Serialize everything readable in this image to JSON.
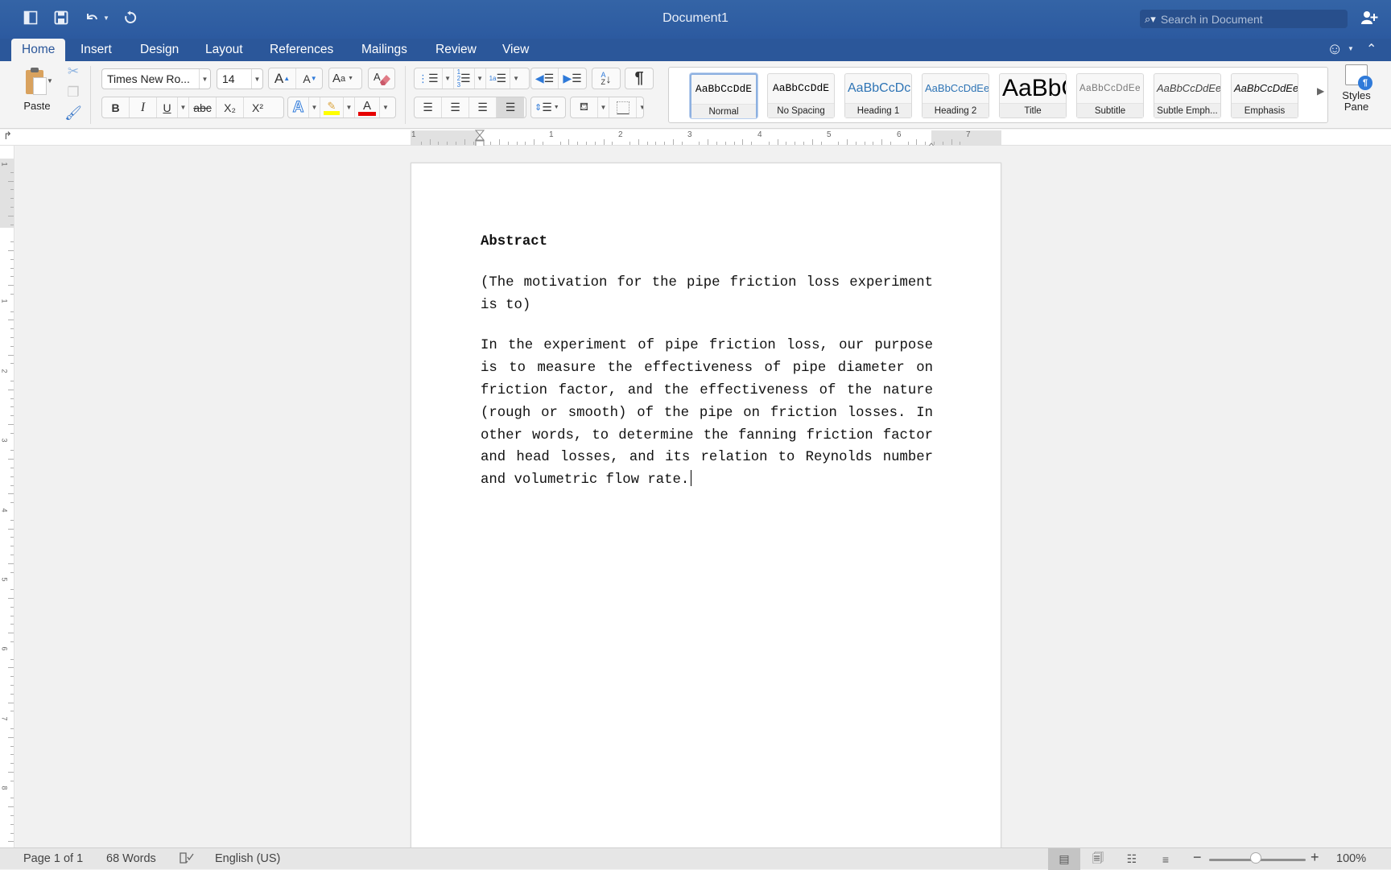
{
  "window": {
    "title": "Document1",
    "search_placeholder": "Search in Document"
  },
  "quick_access": {
    "sidebar": "sidebar-toggle",
    "save": "save",
    "undo": "undo",
    "redo": "redo"
  },
  "tabs": [
    {
      "label": "Home",
      "active": true
    },
    {
      "label": "Insert"
    },
    {
      "label": "Design"
    },
    {
      "label": "Layout"
    },
    {
      "label": "References"
    },
    {
      "label": "Mailings"
    },
    {
      "label": "Review"
    },
    {
      "label": "View"
    }
  ],
  "ribbon": {
    "paste_label": "Paste",
    "font_name": "Times New Ro...",
    "font_size": "14",
    "grow_font": "A▴",
    "shrink_font": "A▾",
    "bold": "B",
    "italic": "I",
    "underline": "U",
    "strikethrough": "abc",
    "subscript": "X₂",
    "superscript": "X²",
    "highlight_color": "#ffff00",
    "font_color": "#e60000",
    "styles": [
      {
        "sample": "AaBbCcDdE",
        "label": "Normal",
        "selected": true
      },
      {
        "sample": "AaBbCcDdE",
        "label": "No Spacing"
      },
      {
        "sample": "AaBbCcDc",
        "label": "Heading 1"
      },
      {
        "sample": "AaBbCcDdEe",
        "label": "Heading 2"
      },
      {
        "sample": "AaBbC",
        "label": "Title"
      },
      {
        "sample": "AaBbCcDdEe",
        "label": "Subtitle"
      },
      {
        "sample": "AaBbCcDdEe",
        "label": "Subtle Emph..."
      },
      {
        "sample": "AaBbCcDdEe",
        "label": "Emphasis"
      }
    ],
    "styles_pane_line1": "Styles",
    "styles_pane_line2": "Pane"
  },
  "ruler": {
    "numbers": [
      "1",
      "1",
      "2",
      "3",
      "4",
      "5",
      "6",
      "7"
    ],
    "vertical_numbers": [
      "1",
      "1",
      "2",
      "3",
      "4",
      "5",
      "6",
      "7",
      "8"
    ]
  },
  "document": {
    "heading": "Abstract",
    "paragraphs": [
      "(The motivation for the pipe friction loss experiment is to)",
      "In the experiment of pipe friction loss, our purpose is to measure the effectiveness of pipe diameter on friction factor, and the effectiveness of the nature (rough or smooth) of the pipe on friction losses. In other words, to determine the fanning friction factor and head losses, and its relation to Reynolds number and volumetric flow rate."
    ]
  },
  "status": {
    "page": "Page 1 of 1",
    "words": "68 Words",
    "language": "English (US)",
    "zoom": "100%",
    "zoom_percent": 100,
    "active_view": "print-layout"
  }
}
